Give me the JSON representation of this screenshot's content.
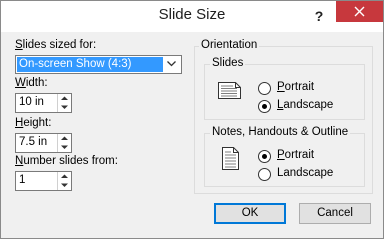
{
  "window": {
    "title": "Slide Size",
    "help_label": "?"
  },
  "slides_sized_for": {
    "label_prefix": "",
    "label_accel": "S",
    "label_rest": "lides sized for:",
    "value": "On-screen Show (4:3)"
  },
  "width": {
    "label_accel": "W",
    "label_rest": "idth:",
    "value": "10 in"
  },
  "height": {
    "label_accel": "H",
    "label_rest": "eight:",
    "value": "7.5 in"
  },
  "number_from": {
    "label_accel": "N",
    "label_rest": "umber slides from:",
    "value": "1"
  },
  "orientation": {
    "title": "Orientation",
    "slides": {
      "title": "Slides",
      "portrait_accel": "P",
      "portrait_rest": "ortrait",
      "landscape_accel": "L",
      "landscape_rest": "andscape",
      "selected": "landscape"
    },
    "notes": {
      "title": "Notes, Handouts & Outline",
      "portrait_accel": "P",
      "portrait_rest": "ortrait",
      "landscape_accel": "",
      "landscape_label": "Landscape",
      "selected": "portrait"
    }
  },
  "buttons": {
    "ok": "OK",
    "cancel": "Cancel"
  },
  "colors": {
    "close_red": "#c7383d",
    "selection_blue": "#3399ff",
    "default_button_border": "#0078d7"
  }
}
